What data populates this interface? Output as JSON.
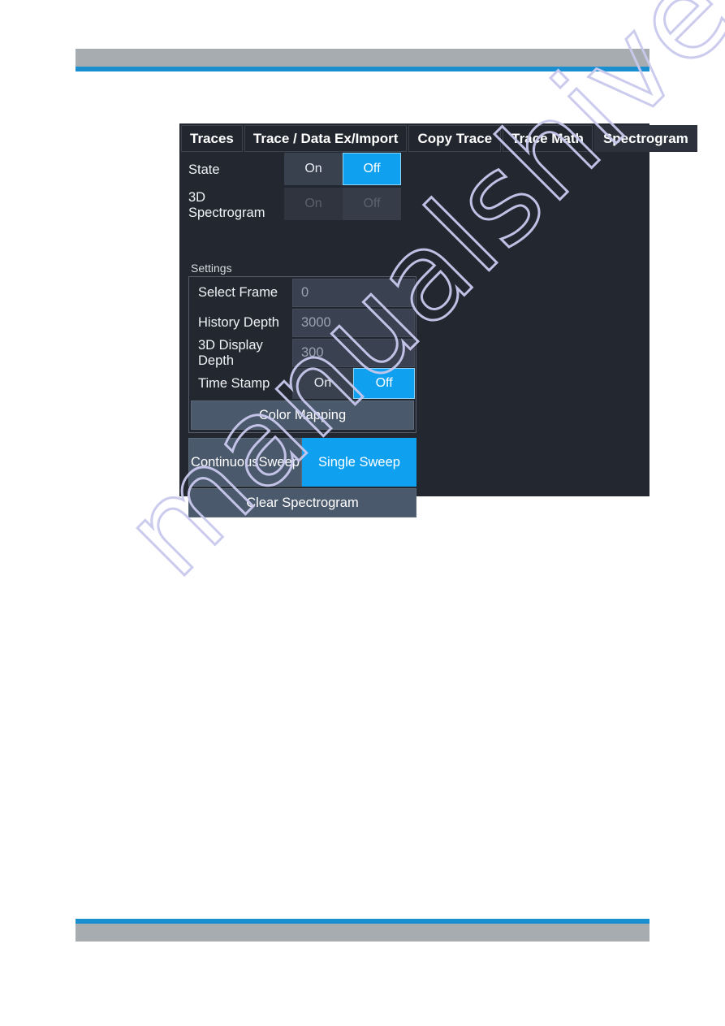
{
  "page": {
    "watermark_text": "manualshive.com"
  },
  "colors": {
    "accent_blue": "#0fa0f0",
    "rule_blue": "#1a8fd0",
    "header_gray": "#a6acb0",
    "panel_bg": "#232730",
    "button_bg": "#4b596c",
    "input_bg": "#3a4150",
    "watermark": "#c9c9ee"
  },
  "dialog": {
    "tabs": [
      {
        "label": "Traces",
        "active": false
      },
      {
        "label": "Trace / Data Ex/Import",
        "active": false
      },
      {
        "label": "Copy Trace",
        "active": false
      },
      {
        "label": "Trace Math",
        "active": false
      },
      {
        "label": "Spectrogram",
        "active": true
      }
    ],
    "rows": [
      {
        "label": "State",
        "on_label": "On",
        "off_label": "Off",
        "selected": "Off",
        "enabled": true
      },
      {
        "label": "3D Spectrogram",
        "on_label": "On",
        "off_label": "Off",
        "selected": "Off",
        "enabled": false
      }
    ],
    "settings": {
      "title": "Settings",
      "fields": [
        {
          "label": "Select Frame",
          "value": "0"
        },
        {
          "label": "History Depth",
          "value": "3000"
        },
        {
          "label": "3D Display Depth",
          "value": "300"
        }
      ],
      "time_stamp": {
        "label": "Time Stamp",
        "on_label": "On",
        "off_label": "Off",
        "selected": "Off"
      },
      "color_mapping_label": "Color Mapping"
    },
    "sweep": {
      "continuous_label": "Continuous Sweep",
      "continuous_line1": "Continuous",
      "continuous_line2": "Sweep",
      "single_label": "Single Sweep",
      "selected": "Single Sweep"
    },
    "clear_label": "Clear Spectrogram"
  }
}
